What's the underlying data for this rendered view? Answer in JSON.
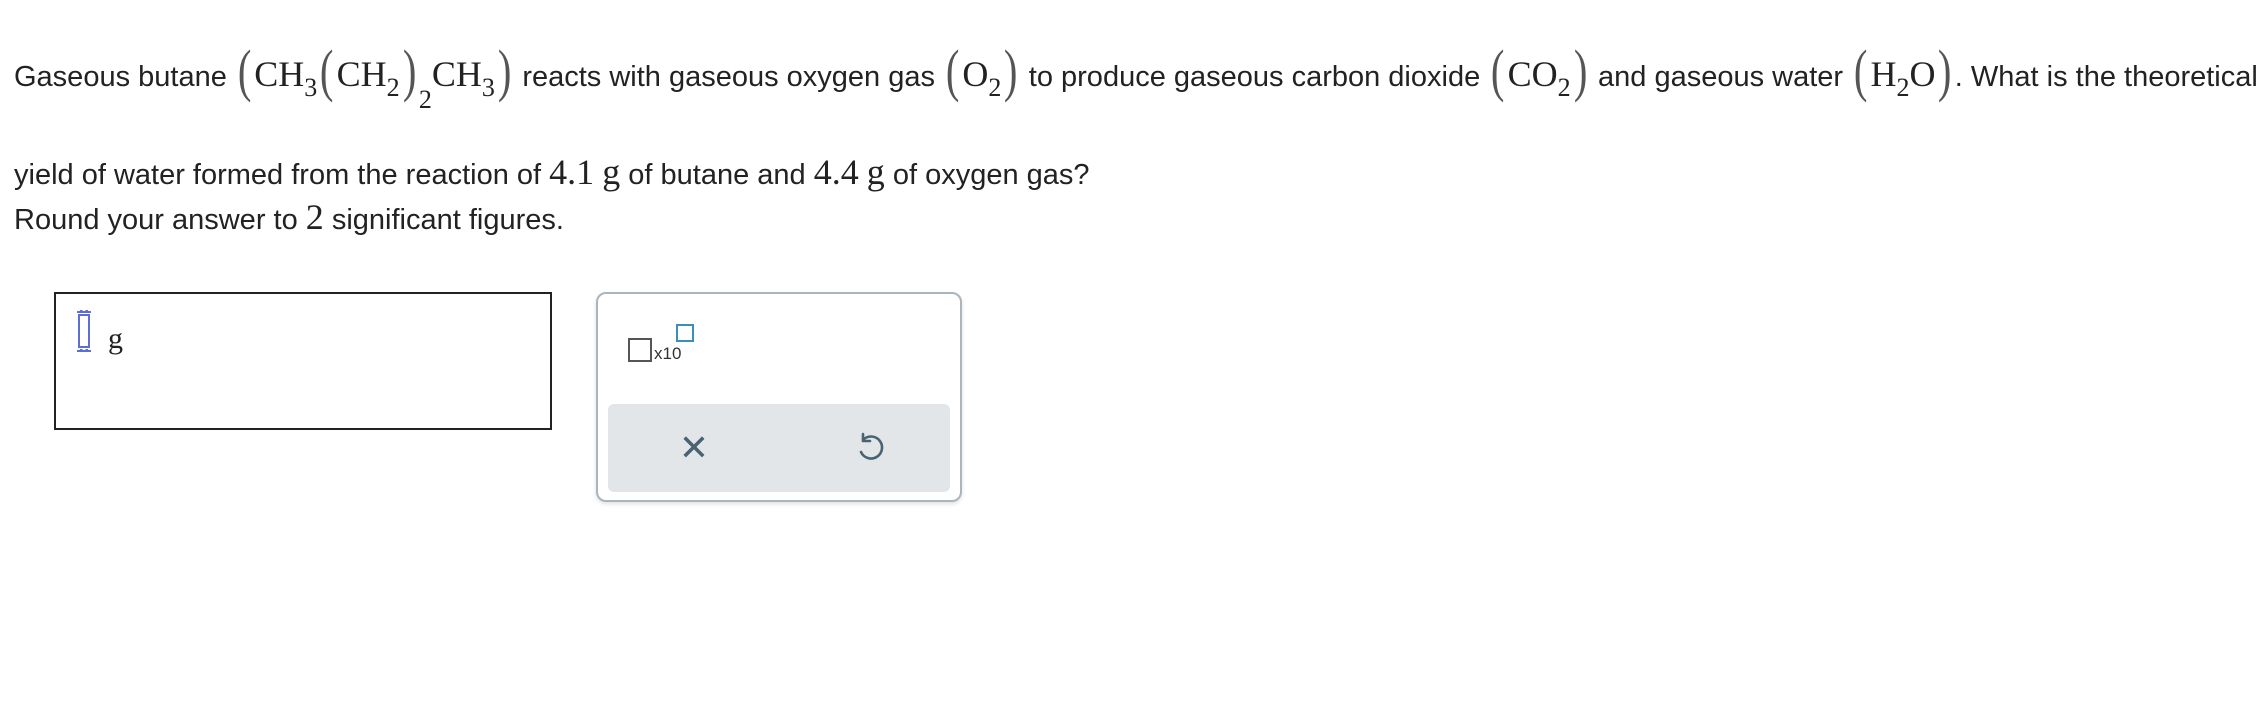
{
  "question": {
    "t1": "Gaseous butane",
    "butane_formula": {
      "a": "CH",
      "a_sub": "3",
      "b": "CH",
      "b_sub": "2",
      "group_sub": "2",
      "c": "CH",
      "c_sub": "3"
    },
    "t2": "reacts with gaseous oxygen gas",
    "oxygen_formula": {
      "a": "O",
      "a_sub": "2"
    },
    "t3": "to produce gaseous carbon dioxide",
    "co2_formula": {
      "a": "CO",
      "a_sub": "2"
    },
    "t4": "and gaseous water",
    "water_formula": {
      "a": "H",
      "a_sub": "2",
      "b": "O"
    },
    "t5": ". What is the theoretical yield of water formed from the reaction of",
    "butane_mass": "4.1",
    "unit_g1": "g",
    "t6": "of butane and",
    "oxygen_mass": "4.4",
    "unit_g2": "g",
    "t7": "of oxygen gas?"
  },
  "instruction": {
    "t1": "Round your answer to",
    "sig_figs": "2",
    "t2": "significant figures."
  },
  "answer": {
    "value": "",
    "unit": "g"
  },
  "tools": {
    "x10_label": "x10",
    "clear_icon": "close-icon",
    "undo_icon": "undo-icon",
    "accent_color": "#3a8fb7",
    "cursor_color": "#5b6fd6"
  }
}
